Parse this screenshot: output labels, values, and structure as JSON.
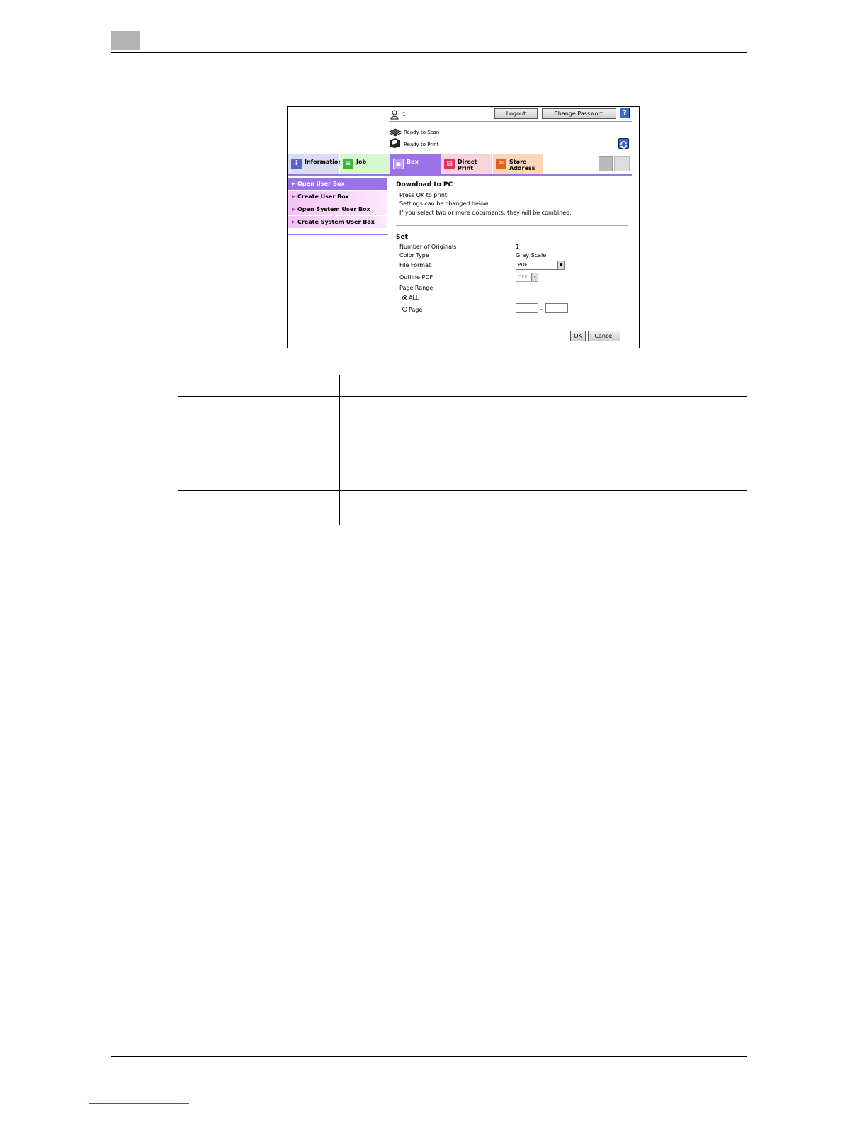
{
  "header": {
    "user_icon": "user-icon",
    "user_name": "1",
    "logout_label": "Logout",
    "change_password_label": "Change Password",
    "help_label": "?"
  },
  "status": {
    "scan": "Ready to Scan",
    "print": "Ready to Print"
  },
  "tabs": [
    {
      "label": "Information",
      "icon": "information-icon"
    },
    {
      "label": "Job",
      "icon": "job-icon"
    },
    {
      "label": "Box",
      "icon": "box-icon"
    },
    {
      "label": "Direct Print",
      "icon": "direct-print-icon"
    },
    {
      "label": "Store\nAddress",
      "icon": "store-address-icon"
    }
  ],
  "active_tab": "Box",
  "sidebar": {
    "items": [
      {
        "label": "Open User Box",
        "active": true
      },
      {
        "label": "Create User Box",
        "active": false
      },
      {
        "label": "Open System User Box",
        "active": false
      },
      {
        "label": "Create System User Box",
        "active": false
      }
    ]
  },
  "main": {
    "title": "Download to PC",
    "messages": [
      "Press OK to print.",
      "Settings can be changed below.",
      "If you select two or more documents, they will be combined."
    ],
    "set_heading": "Set",
    "fields": {
      "number_of_originals": {
        "label": "Number of Originals",
        "value": "1"
      },
      "color_type": {
        "label": "Color Type",
        "value": "Gray Scale"
      },
      "file_format": {
        "label": "File Format",
        "value": "PDF"
      },
      "outline_pdf": {
        "label": "Outline PDF",
        "value": "OFF"
      },
      "page_range": {
        "label": "Page Range",
        "all_label": "ALL",
        "page_label": "Page",
        "selected": "ALL",
        "separator": "-",
        "from": "",
        "to": ""
      }
    },
    "ok_label": "OK",
    "cancel_label": "Cancel"
  },
  "colors": {
    "accent": "#9b73e6",
    "sidebar": "#f4c4f4"
  }
}
